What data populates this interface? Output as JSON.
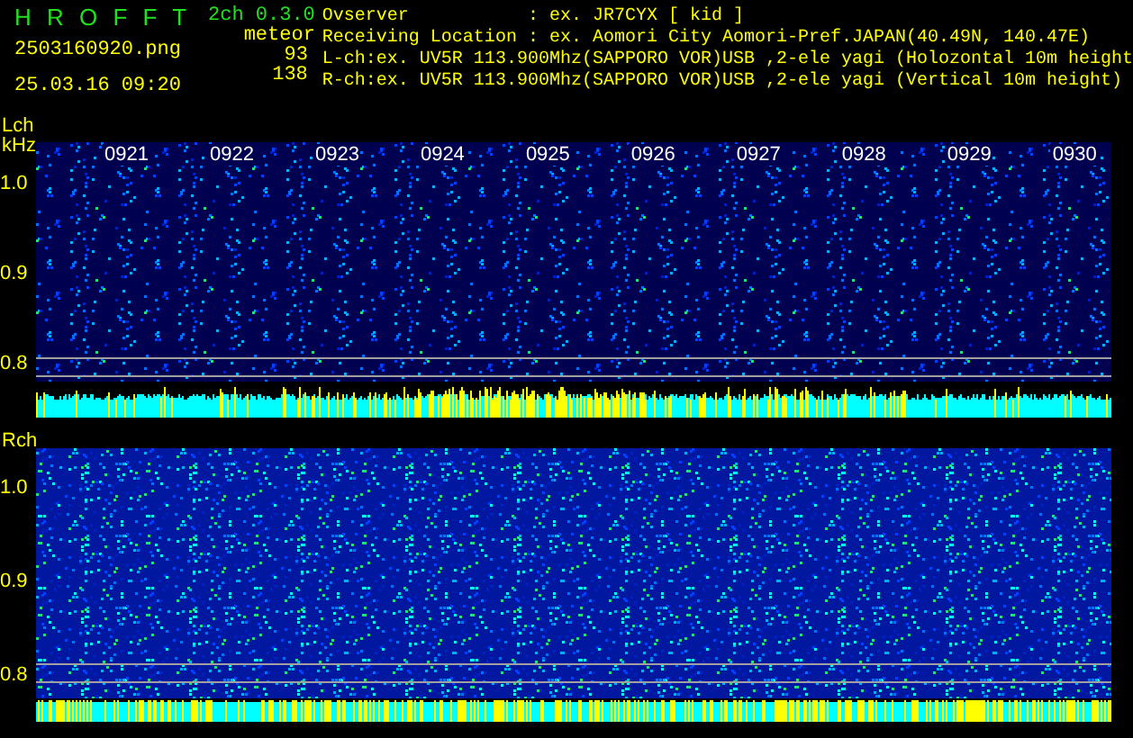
{
  "app": {
    "title": "H R O F F T",
    "version": "2ch 0.3.0",
    "filename": "2503160920.png",
    "datetime": "25.03.16 09:20"
  },
  "meteor": {
    "label": "meteor",
    "counts": [
      "93",
      "138"
    ]
  },
  "info_lines": [
    "Ovserver           : ex. JR7CYX [ kid ]",
    "Receiving Location : ex. Aomori City Aomori-Pref.JAPAN(40.49N, 140.47E)",
    "L-ch:ex. UV5R 113.900Mhz(SAPPORO VOR)USB ,2-ele yagi (Holozontal 10m height",
    "R-ch:ex. UV5R 113.900Mhz(SAPPORO VOR)USB ,2-ele yagi (Vertical 10m height)"
  ],
  "channels": [
    {
      "label": "Lch",
      "unit": "kHz",
      "time_labels": [
        "0921",
        "0922",
        "0923",
        "0924",
        "0925",
        "0926",
        "0927",
        "0928",
        "0929",
        "0930"
      ],
      "y_labels": [
        "1.0",
        "0.9",
        "0.8"
      ]
    },
    {
      "label": "Rch",
      "y_labels": [
        "1.0",
        "0.9",
        "0.8"
      ]
    }
  ]
}
